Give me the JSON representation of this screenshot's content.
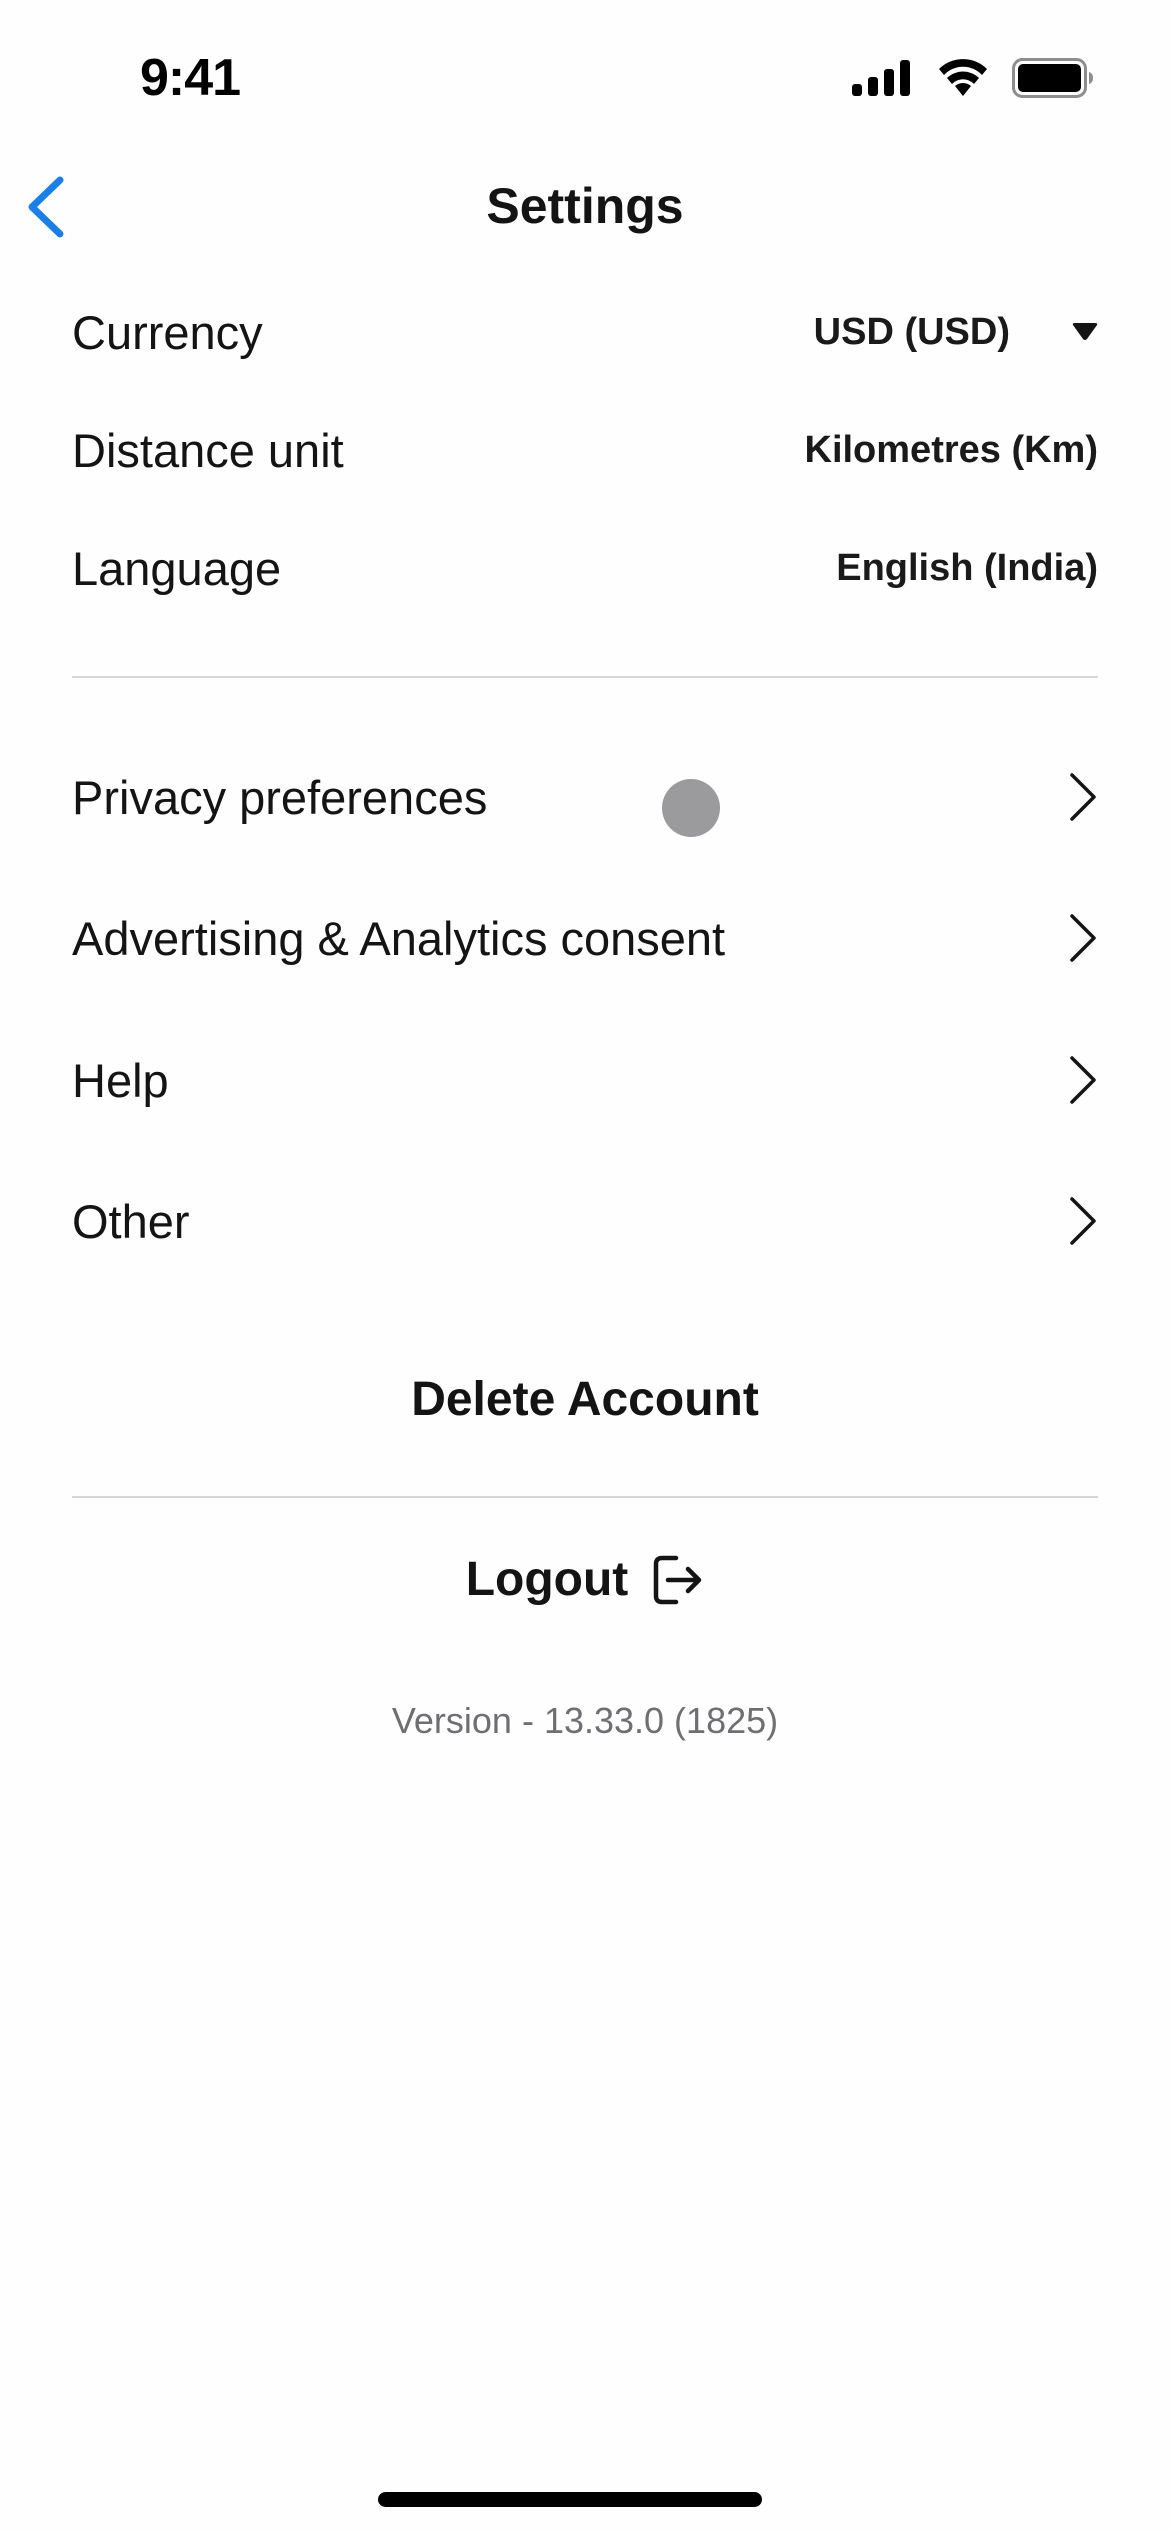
{
  "status_bar": {
    "time": "9:41",
    "icons": [
      "cellular-signal-icon",
      "wifi-icon",
      "battery-icon"
    ]
  },
  "nav": {
    "title": "Settings",
    "back_icon": "chevron-left-icon",
    "accent_color": "#1a7fe6"
  },
  "preferences": [
    {
      "label": "Currency",
      "value": "USD (USD)",
      "has_dropdown": true
    },
    {
      "label": "Distance unit",
      "value": "Kilometres (Km)"
    },
    {
      "label": "Language",
      "value": "English (India)"
    }
  ],
  "links": [
    {
      "label": "Privacy preferences"
    },
    {
      "label": "Advertising & Analytics consent"
    },
    {
      "label": "Help"
    },
    {
      "label": "Other"
    }
  ],
  "actions": {
    "delete_account": "Delete Account",
    "logout": "Logout",
    "logout_icon": "logout-icon"
  },
  "footer": {
    "version": "Version - 13.33.0 (1825)"
  }
}
